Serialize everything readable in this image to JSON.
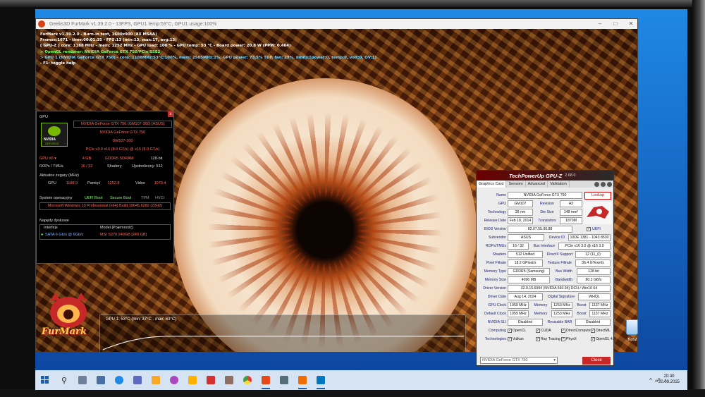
{
  "furmark": {
    "window_title": "Geeks3D FurMark v1.39.2.0 - 13FPS, GPU1 temp:53°C, GPU1 usage:100%",
    "osd": [
      "FurMark v1.39.2.0 - Burn-in test, 1600x900 (8X MSAA)",
      "Frames:1671 - time:00:01:35 - FPS:13 (min:13, max:17, avg:13)",
      "[ GPU-Z ] core: 1188 MHz - mem: 1252 MHz - GPU load: 100 % - GPU temp: 53 °C - Board power: 20.8 W (PPW: 0.464)",
      "> OpenGL renderer: NVIDIA GeForce GTX 750/PCIe/SSE2",
      "> GPU 1 (NVIDIA GeForce GTX 750) - core: 1188MHz:53°C:100%, mem: 2505MHz:1%, GPU power: 73.5% TDP, fan: 29%, limits:[power:0, temp:0, volt:0, OV:1]",
      "- F1: toggle help"
    ],
    "logo_text": "FurMark",
    "temp_graph_label": "GPU 1: 53°C (min: 37°C - max: 63°C)"
  },
  "gpu_info": {
    "section_gpu": "GPU",
    "gpu_name": "NVIDIA GeForce GTX 750 (GM107-300) [ASUS]",
    "gpu_name2": "NVIDIA GeForce GTX 750",
    "gpu_chip": "GM107-300",
    "pcie": "PCIe v3.0 x16 (8.0 GT/s) @ x16 (8.0 GT/s)",
    "gpu_select": "GPU #0",
    "memory_size": "4 GB",
    "memory_type": "GDDR5 SDRAM",
    "bus_width": "128-bit",
    "rops_label": "ROPs / TMUs",
    "rops_value": "16 / 32",
    "shaders_label": "Shadery",
    "unified_label": "Ujednolicony: 512",
    "clocks_title": "Aktualne zegary (MHz)",
    "clock_gpu_label": "GPU",
    "clock_gpu": "1188.9",
    "clock_mem_label": "Pamięć",
    "clock_mem": "1252.8",
    "clock_video_label": "Video",
    "clock_video": "1070.4",
    "os_label": "System operacyjny",
    "uefi": "UEFI Boot",
    "secure": "Secure Boot",
    "tpm": "TPM",
    "hvci": "HVCI",
    "os_value": "Microsoft Windows 10 Professional (x64) Build 19045.6282 (22H2)",
    "drives_title": "Napędy dyskowe",
    "col_interface": "Interfejs",
    "col_model": "Model [Pojemność]",
    "drive_interface": "SATA 6 Gb/s @ 6Gb/s",
    "drive_model": "MSI S270 240GB [240 GB]",
    "nvidia_word": "NVIDIA",
    "nvidia_sub": "GEFORCE"
  },
  "gpuz": {
    "title": "TechPowerUp GPU-Z",
    "version": "2.68.0",
    "tabs": [
      "Graphics Card",
      "Sensors",
      "Advanced",
      "Validation"
    ],
    "lookup": "Lookup",
    "rows": {
      "name_label": "Name",
      "name": "NVIDIA GeForce GTX 750",
      "gpu_label": "GPU",
      "gpu": "GM107",
      "revision_label": "Revision",
      "revision": "A2",
      "tech_label": "Technology",
      "tech": "28 nm",
      "die_label": "Die Size",
      "die": "148 mm²",
      "release_label": "Release Date",
      "release": "Feb 18, 2014",
      "trans_label": "Transistors",
      "trans": "1870M",
      "bios_label": "BIOS Version",
      "bios": "82.07.55.00.88",
      "uefi_label": "UEFI",
      "subvendor_label": "Subvendor",
      "subvendor": "ASUS",
      "devid_label": "Device ID",
      "devid": "10DE 1381 - 1043 8530",
      "rops_label": "ROPs/TMUs",
      "rops": "16 / 32",
      "busif_label": "Bus Interface",
      "busif": "PCIe x16 3.0 @ x16 3.0",
      "shaders_label": "Shaders",
      "shaders": "512 Unified",
      "dx_label": "DirectX Support",
      "dx": "12 (11_0)",
      "pixel_label": "Pixel Fillrate",
      "pixel": "18.2 GPixel/s",
      "texture_label": "Texture Fillrate",
      "texture": "36.4 GTexel/s",
      "memtype_label": "Memory Type",
      "memtype": "GDDR5 (Samsung)",
      "buswidth_label": "Bus Width",
      "buswidth": "128 bit",
      "memsize_label": "Memory Size",
      "memsize": "4096 MB",
      "bandwidth_label": "Bandwidth",
      "bandwidth": "80.2 GB/s",
      "driver_label": "Driver Version",
      "driver": "32.0.15.6094 (NVIDIA 560.94) DCH / Win10 64",
      "drvdate_label": "Driver Date",
      "drvdate": "Aug 14, 2024",
      "digsig_label": "Digital Signature",
      "digsig": "WHQL",
      "gpuclk_label": "GPU Clock",
      "gpuclk": "1059 MHz",
      "memclk_label": "Memory",
      "memclk": "1253 MHz",
      "boost_label": "Boost",
      "boost": "1137 MHz",
      "defclk_label": "Default Clock",
      "defclk": "1059 MHz",
      "defmem_label": "Memory",
      "defmem": "1253 MHz",
      "defboost_label": "Boost",
      "defboost": "1137 MHz",
      "sli_label": "NVIDIA SLI",
      "sli": "Disabled",
      "rebar_label": "Resizable BAR",
      "rebar": "Disabled",
      "computing_label": "Computing",
      "technologies_label": "Technologies"
    },
    "computing": [
      "OpenCL",
      "CUDA",
      "DirectCompute",
      "DirectML"
    ],
    "technologies": [
      "Vulkan",
      "Ray Tracing",
      "PhysX",
      "OpenGL 4.6"
    ],
    "selected_card": "NVIDIA GeForce GTX 750",
    "close": "Close"
  },
  "desktop": {
    "recycle_bin": "Kosz"
  },
  "taskbar": {
    "time": "20:40",
    "date": "20.09.2025"
  },
  "colors": {
    "osd_text": "#ffffff",
    "osd_green": "#7dff6b",
    "osd_cyan": "#7fd9ff",
    "gpuz_red": "#c62828",
    "taskbar": "#d5e3f2"
  },
  "graph": {
    "temp_min_c": 37,
    "temp_max_c": 63,
    "temp_current_c": 53
  }
}
